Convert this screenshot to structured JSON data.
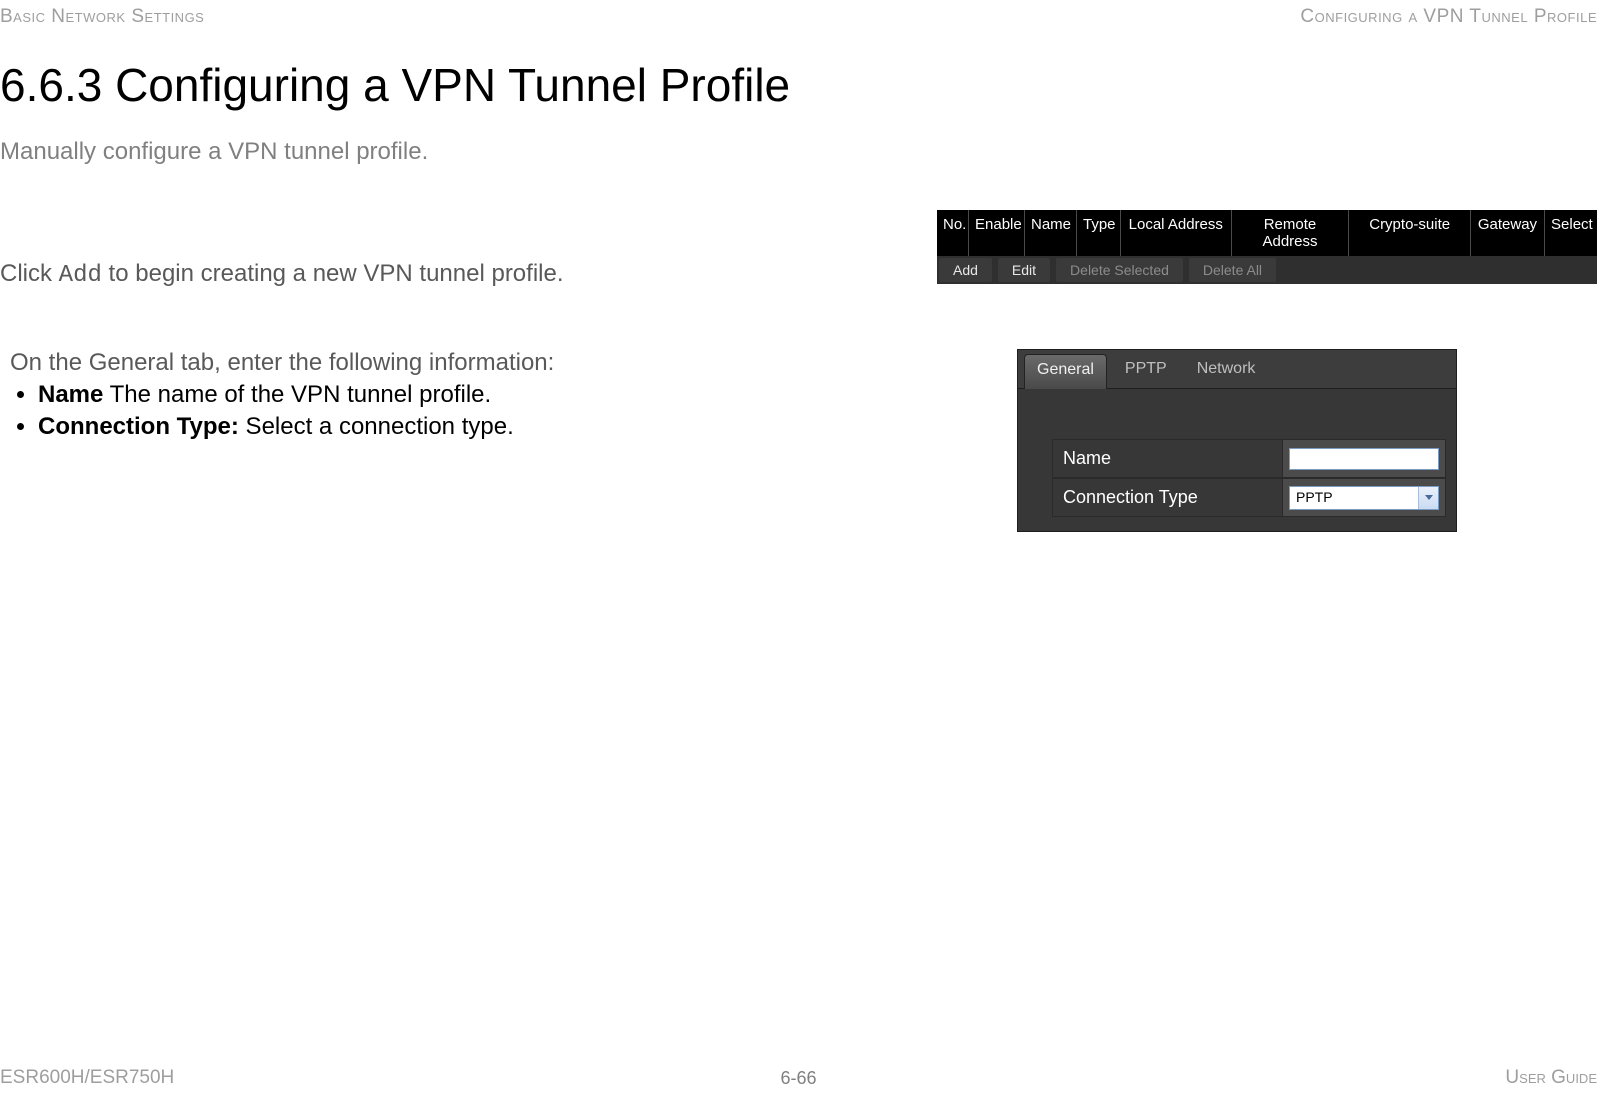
{
  "header": {
    "left": "Basic Network Settings",
    "right": "Configuring a VPN Tunnel Profile"
  },
  "title": "6.6.3 Configuring a VPN Tunnel Profile",
  "subtitle": "Manually configure a VPN tunnel profile.",
  "step1": {
    "pre": "Click ",
    "code": "Add",
    "post": " to begin creating a new VPN tunnel profile."
  },
  "vpn_table": {
    "headers": {
      "no": "No.",
      "enable": "Enable",
      "name": "Name",
      "type": "Type",
      "local": "Local Address",
      "remote": "Remote Address",
      "crypto": "Crypto-suite",
      "gateway": "Gateway",
      "select": "Select"
    },
    "actions": {
      "add": "Add",
      "edit": "Edit",
      "delete_selected": "Delete Selected",
      "delete_all": "Delete All"
    }
  },
  "step2": {
    "intro": "On the General tab, enter the following information:",
    "items": [
      {
        "label": "Name",
        "desc": "  The name of the VPN tunnel profile."
      },
      {
        "label": "Connection Type:",
        "desc": " Select a connection type."
      }
    ]
  },
  "panel": {
    "tabs": {
      "general": "General",
      "pptp": "PPTP",
      "network": "Network"
    },
    "fields": {
      "name_label": "Name",
      "name_value": "",
      "conn_label": "Connection Type",
      "conn_value": "PPTP"
    }
  },
  "footer": {
    "left": "ESR600H/ESR750H",
    "center": "6-66",
    "right": "User Guide"
  }
}
